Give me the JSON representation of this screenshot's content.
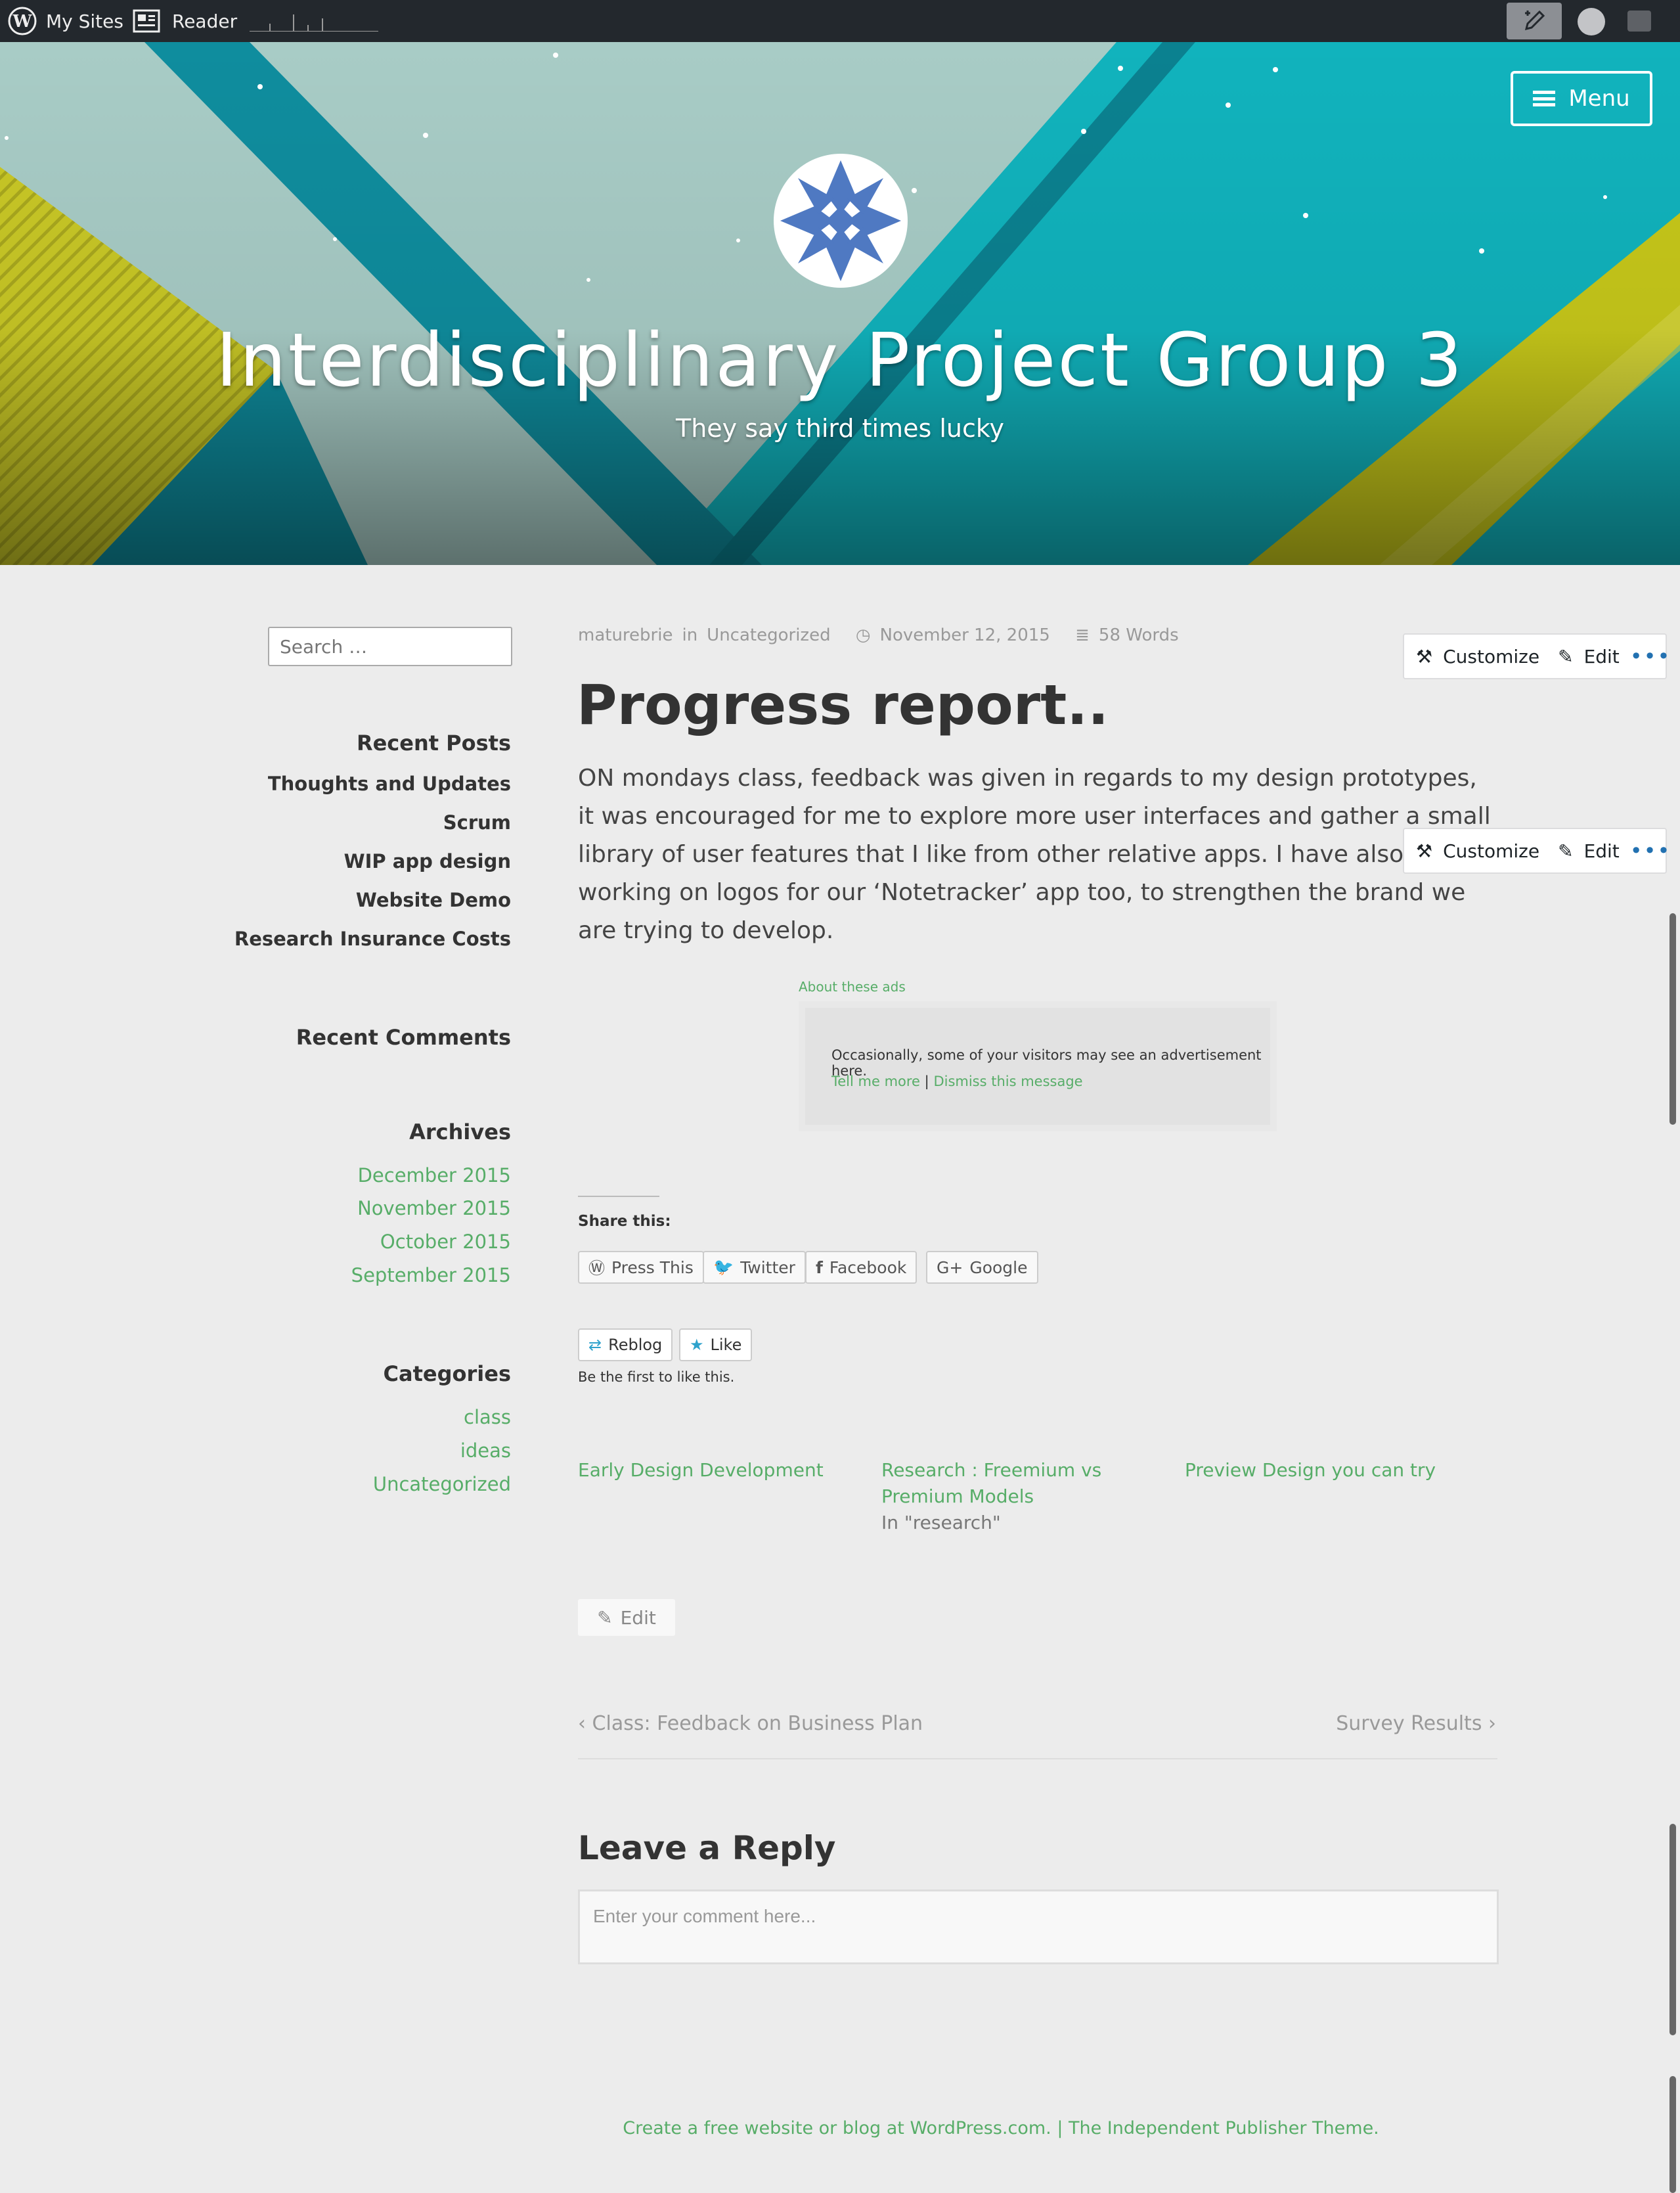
{
  "adminbar": {
    "my_sites": "My Sites",
    "reader": "Reader"
  },
  "header": {
    "menu_label": "Menu",
    "site_title": "Interdisciplinary Project Group 3",
    "tagline": "They say third times lucky"
  },
  "sidebar": {
    "search_placeholder": "Search …",
    "recent_posts_title": "Recent Posts",
    "recent_posts": [
      "Thoughts and Updates",
      "Scrum",
      "WIP app design",
      "Website Demo",
      "Research Insurance Costs"
    ],
    "recent_comments_title": "Recent Comments",
    "archives_title": "Archives",
    "archives": [
      "December 2015",
      "November 2015",
      "October 2015",
      "September 2015"
    ],
    "categories_title": "Categories",
    "categories": [
      "class",
      "ideas",
      "Uncategorized"
    ]
  },
  "post": {
    "author": "maturebrie",
    "in": "in",
    "category": "Uncategorized",
    "date": "November 12, 2015",
    "word_count": "58 Words",
    "title": "Progress report..",
    "body": "ON mondays class, feedback was given in regards to my design prototypes, it was encouraged for me to explore more user interfaces and gather a small library of user features that I like from other relative apps. I have also been working on logos for our ‘Notetracker’ app too, to strengthen the brand we are trying to develop."
  },
  "edit_toolbar": {
    "customize": "Customize",
    "edit": "Edit",
    "more": "•••"
  },
  "ads": {
    "about": "About these ads",
    "message": "Occasionally, some of your visitors may see an advertisement here.",
    "tell_more": "Tell me more",
    "separator": "|",
    "dismiss": "Dismiss this message"
  },
  "share": {
    "title": "Share this:",
    "buttons": [
      "Press This",
      "Twitter",
      "Facebook",
      "Google"
    ]
  },
  "like": {
    "reblog": "Reblog",
    "like": "Like",
    "text": "Be the first to like this."
  },
  "related": [
    {
      "title": "Early Design Development",
      "context": ""
    },
    {
      "title": "Research : Freemium vs Premium Models",
      "context": "In \"research\""
    },
    {
      "title": "Preview Design you can try",
      "context": ""
    }
  ],
  "edit_button": "Edit",
  "nav": {
    "prev": "Class: Feedback on Business Plan",
    "next": "Survey Results"
  },
  "reply": {
    "title": "Leave a Reply",
    "placeholder": "Enter your comment here..."
  },
  "footer": {
    "text1": "Create a free website or blog at WordPress.com.",
    "sep": " | ",
    "text2": "The Independent Publisher Theme."
  },
  "colors": {
    "accent": "#57ad68",
    "adminbar": "#23282d",
    "teal": "#0c8a9b",
    "yellow": "#c7c81a"
  }
}
